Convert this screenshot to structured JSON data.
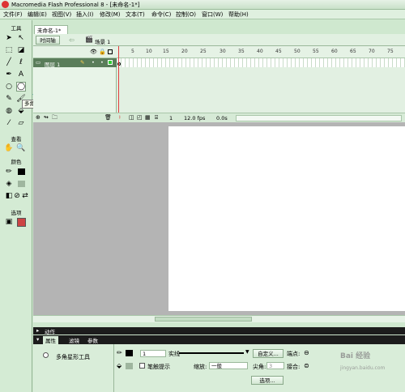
{
  "window": {
    "title": "Macromedia Flash Professional 8 - [未命名-1*]"
  },
  "menu": [
    "文件(F)",
    "编辑(E)",
    "视图(V)",
    "插入(I)",
    "修改(M)",
    "文本(T)",
    "命令(C)",
    "控制(O)",
    "窗口(W)",
    "帮助(H)"
  ],
  "tools": {
    "header": "工具",
    "view_header": "查看",
    "color_header": "颜色",
    "options_header": "选项",
    "tooltip": "多角星形工具"
  },
  "document": {
    "tab": "未命名-1*"
  },
  "scenebar": {
    "timeline_button": "时间轴",
    "scene_label": "场景 1"
  },
  "timeline": {
    "layer_name": "图层 1",
    "ruler": [
      "5",
      "10",
      "15",
      "20",
      "25",
      "30",
      "35",
      "40",
      "45",
      "50",
      "55",
      "60",
      "65",
      "70",
      "75"
    ],
    "current_frame": "1",
    "fps": "12.0 fps",
    "time": "0.0s"
  },
  "panels": {
    "actions": "动作",
    "tabs": [
      "属性",
      "滤镜",
      "参数"
    ]
  },
  "properties": {
    "tool_name": "多角星形工具",
    "stroke_size": "1",
    "stroke_style": "实线",
    "custom_button": "自定义...",
    "cap_label": "端点:",
    "stroke_hint": "笔触提示",
    "scale_label": "缩放:",
    "scale_value": "一般",
    "miter_label": "尖角:",
    "miter_value": "3",
    "join_label": "接合:",
    "options_button": "选项..."
  },
  "watermark": {
    "line1": "Bai 经验",
    "line2": "jingyan.baidu.com"
  },
  "colors": {
    "accent": "#5aa55a",
    "playhead": "#e03c3c",
    "arrow": "#2a8fa0"
  }
}
